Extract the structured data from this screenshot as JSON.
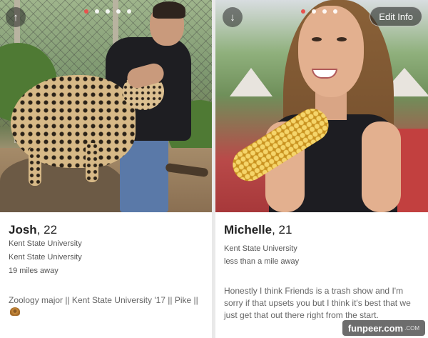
{
  "left_profile": {
    "name": "Josh",
    "age": "22",
    "school_1": "Kent State University",
    "school_2": "Kent State University",
    "distance": "19 miles away",
    "bio": "Zoology major || Kent State University '17 || Pike ||",
    "photo_dots": 5,
    "active_dot": 1
  },
  "right_profile": {
    "name": "Michelle",
    "age": "21",
    "school": "Kent State University",
    "distance": "less than a mile away",
    "bio": "Honestly I think Friends is a trash show and I'm sorry if that upsets you but I think it's best that we just get that out there right from the start.",
    "edit_label": "Edit Info",
    "photo_dots": 4,
    "active_dot": 0
  },
  "icons": {
    "collapse": "arrow-up-icon",
    "expand": "arrow-down-icon",
    "bio_emoji": "snail-icon"
  },
  "colors": {
    "active_dot": "#e8524e",
    "divider": "#e9e9e9"
  },
  "watermark": {
    "text": "funpeer.com",
    "suffix": ".COM"
  }
}
